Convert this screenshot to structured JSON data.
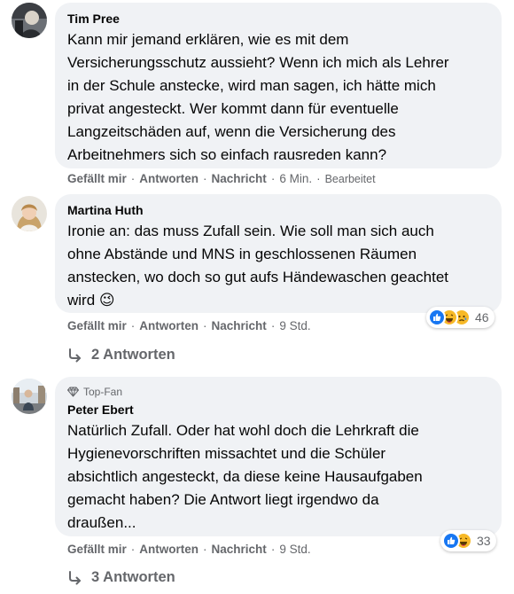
{
  "comments": [
    {
      "author": "Tim Pree",
      "text": "Kann mir jemand erklären, wie es mit dem\nVersicherungsschutz aussieht? Wenn ich mich als Lehrer\nin der Schule anstecke, wird man sagen, ich hätte mich\nprivat angesteckt. Wer kommt dann für eventuelle\nLangzeitschäden auf, wenn die Versicherung des\nArbeitnehmers sich so einfach rausreden kann?",
      "actions": {
        "like": "Gefällt mir",
        "reply": "Antworten",
        "message": "Nachricht"
      },
      "time": "6 Min.",
      "edited": "Bearbeitet"
    },
    {
      "author": "Martina Huth",
      "text": "Ironie an: das muss Zufall sein. Wie soll man sich auch\nohne Abstände und MNS in geschlossenen Räumen\nanstecken, wo doch so gut aufs Händewaschen geachtet\nwird",
      "emoji": "😉",
      "actions": {
        "like": "Gefällt mir",
        "reply": "Antworten",
        "message": "Nachricht"
      },
      "time": "9 Std.",
      "reactions": {
        "icons": [
          "like",
          "haha",
          "sad"
        ],
        "count": "46"
      },
      "replies": "2 Antworten"
    },
    {
      "badge": "Top-Fan",
      "author": "Peter Ebert",
      "text": "Natürlich Zufall. Oder hat wohl doch die Lehrkraft die\nHygienevorschriften missachtet und die Schüler\nabsichtlich angesteckt, da diese keine Hausaufgaben\ngemacht haben? Die Antwort liegt irgendwo da\ndraußen...",
      "actions": {
        "like": "Gefällt mir",
        "reply": "Antworten",
        "message": "Nachricht"
      },
      "time": "9 Std.",
      "reactions": {
        "icons": [
          "like",
          "haha"
        ],
        "count": "33"
      },
      "replies": "3 Antworten"
    }
  ],
  "separator": "·",
  "colors": {
    "like_blue": "#1877f2",
    "meta_gray": "#65676b",
    "bubble_bg": "#f0f2f5",
    "haha_yellow": "#f7b928"
  }
}
